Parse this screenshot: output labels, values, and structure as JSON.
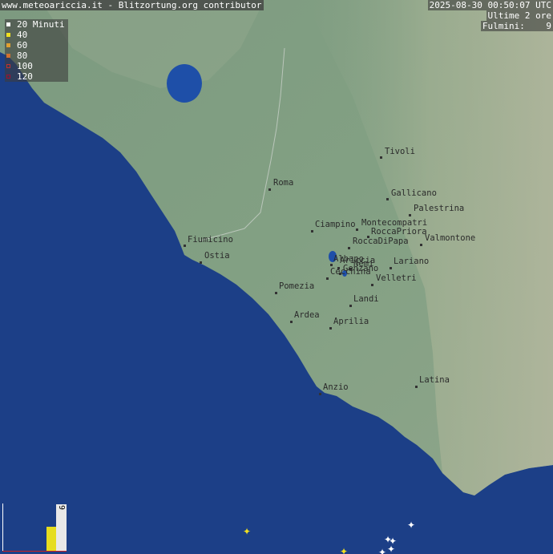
{
  "header": {
    "source": "www.meteoariccia.it - Blitzortung.org contributor",
    "timestamp": "2025-08-30 00:50:07 UTC",
    "window": "Ultime 2 ore",
    "strike_label": "Fulmini:",
    "strike_count": "9"
  },
  "legend": {
    "items": [
      {
        "label": "20 Minuti",
        "color": "#ffffff"
      },
      {
        "label": "40",
        "color": "#f0e020"
      },
      {
        "label": "60",
        "color": "#e0a030"
      },
      {
        "label": "80",
        "color": "#d07030"
      },
      {
        "label": "100",
        "color": "#c03030"
      },
      {
        "label": "120",
        "color": "#a01030"
      }
    ]
  },
  "places": [
    {
      "name": "Tivoli"
    },
    {
      "name": "Roma"
    },
    {
      "name": "Gallicano"
    },
    {
      "name": "Palestrina"
    },
    {
      "name": "Montecompatri"
    },
    {
      "name": "Ciampino"
    },
    {
      "name": "RoccaPriora"
    },
    {
      "name": "RoccaDiPapa"
    },
    {
      "name": "Valmontone"
    },
    {
      "name": "Fiumicino"
    },
    {
      "name": "Ostia"
    },
    {
      "name": "Albano"
    },
    {
      "name": "Ariccia"
    },
    {
      "name": "Nemi"
    },
    {
      "name": "Genzano"
    },
    {
      "name": "Cecchina"
    },
    {
      "name": "Lariano"
    },
    {
      "name": "Velletri"
    },
    {
      "name": "Pomezia"
    },
    {
      "name": "Landi"
    },
    {
      "name": "Ardea"
    },
    {
      "name": "Aprilia"
    },
    {
      "name": "Anzio"
    },
    {
      "name": "Latina"
    }
  ],
  "histogram": {
    "count": "9"
  },
  "colors": {
    "sea": "#1c3f87",
    "land": "#7a9a7c",
    "hills": "#9aa88a",
    "lake": "#1e4fa8"
  }
}
